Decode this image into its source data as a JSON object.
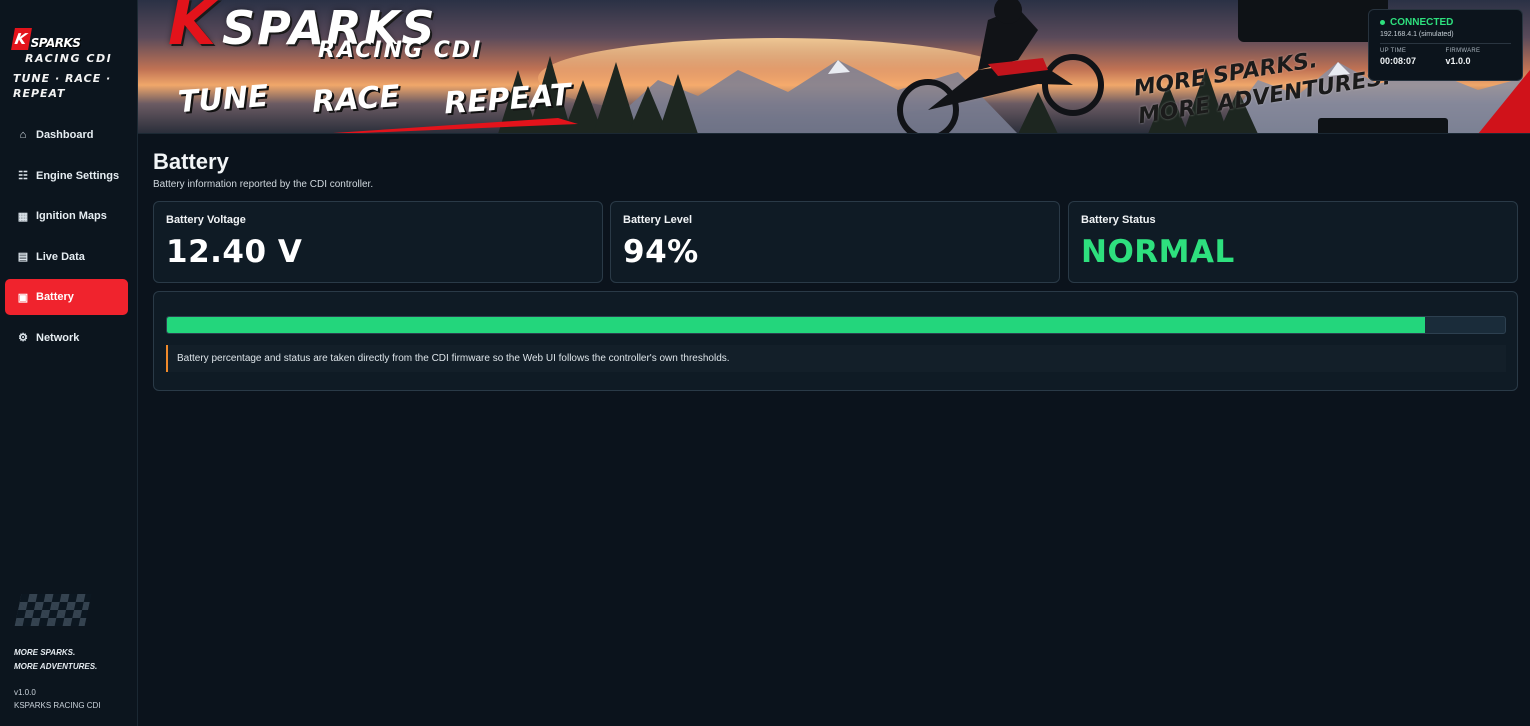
{
  "brand": {
    "logo_k": "K",
    "logo_word": "SPARKS",
    "subtitle": "RACING CDI",
    "tagline": "TUNE · RACE · REPEAT"
  },
  "sidebar": {
    "items": [
      {
        "label": "Dashboard",
        "icon": "home-icon",
        "active": false
      },
      {
        "label": "Engine Settings",
        "icon": "sliders-icon",
        "active": false
      },
      {
        "label": "Ignition Maps",
        "icon": "grid-icon",
        "active": false
      },
      {
        "label": "Live Data",
        "icon": "table-icon",
        "active": false
      },
      {
        "label": "Battery",
        "icon": "battery-icon",
        "active": true
      },
      {
        "label": "Network",
        "icon": "gear-icon",
        "active": false
      }
    ],
    "slogan_line1": "MORE SPARKS.",
    "slogan_line2": "MORE ADVENTURES.",
    "version": "v1.0.0",
    "product": "KSPARKS RACING CDI"
  },
  "banner": {
    "title_k": "K",
    "title_rest": "SPARKS",
    "subtitle": "RACING CDI",
    "words": [
      "TUNE",
      "RACE",
      "REPEAT"
    ],
    "slogan_line1": "MORE SPARKS.",
    "slogan_line2": "MORE ADVENTURES."
  },
  "connection": {
    "status": "CONNECTED",
    "ip": "192.168.4.1 (simulated)",
    "uptime_label": "UP TIME",
    "uptime_value": "00:08:07",
    "firmware_label": "FIRMWARE",
    "firmware_value": "v1.0.0",
    "status_color": "#2ee07e"
  },
  "page": {
    "title": "Battery",
    "subtitle": "Battery information reported by the CDI controller."
  },
  "cards": {
    "voltage": {
      "label": "Battery Voltage",
      "value": "12.40 V"
    },
    "level": {
      "label": "Battery Level",
      "value": "94%"
    },
    "status": {
      "label": "Battery Status",
      "value": "NORMAL"
    }
  },
  "battery_bar": {
    "level_percent": 94,
    "fill_color": "#23d67c",
    "note": "Battery percentage and status are taken directly from the CDI firmware so the Web UI follows the controller's own thresholds."
  },
  "colors": {
    "accent": "#f0232d",
    "ok": "#2ee07e",
    "note_border": "#f08a2b"
  }
}
